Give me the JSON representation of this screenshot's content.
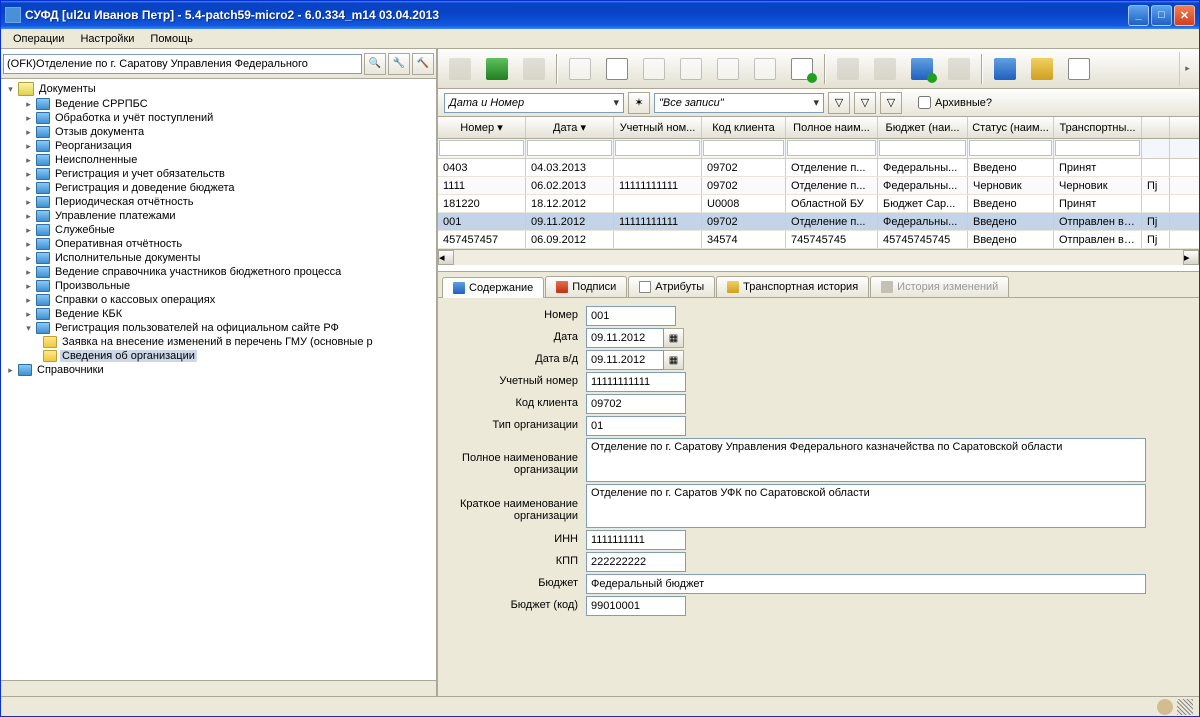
{
  "title": "СУФД [ul2u Иванов Петр] - 5.4-patch59-micro2 - 6.0.334_m14 03.04.2013",
  "menu": {
    "operations": "Операции",
    "settings": "Настройки",
    "help": "Помощь"
  },
  "search": {
    "value": "(ОFК)Отделение по г. Саратову Управления Федерального"
  },
  "tree": {
    "documents": "Документы",
    "items": [
      "Ведение СРРПБС",
      "Обработка и учёт поступлений",
      "Отзыв документа",
      "Реорганизация",
      "Неисполненные",
      "Регистрация и учет обязательств",
      "Регистрация и доведение бюджета",
      "Периодическая отчётность",
      "Управление платежами",
      "Служебные",
      "Оперативная отчётность",
      "Исполнительные документы",
      "Ведение справочника участников бюджетного процесса",
      "Произвольные",
      "Справки о кассовых операциях",
      "Ведение КБК",
      "Регистрация пользователей на официальном сайте РФ"
    ],
    "sub": {
      "a": "Заявка на внесение изменений в перечень ГМУ (основные р",
      "b": "Сведения об организации"
    },
    "references": "Справочники"
  },
  "filter": {
    "view1": "Дата и Номер",
    "view2": "\"Все записи\"",
    "archive": "Архивные?"
  },
  "grid": {
    "cols": {
      "num": "Номер ▾",
      "date": "Дата ▾",
      "acct": "Учетный ном...",
      "client": "Код клиента",
      "name": "Полное наим...",
      "budget": "Бюджет (наи...",
      "status": "Статус (наим...",
      "transport": "Транспортны..."
    },
    "rows": [
      {
        "num": "0403",
        "date": "04.03.2013",
        "acct": "",
        "client": "09702",
        "name": "Отделение п...",
        "budget": "Федеральны...",
        "status": "Введено",
        "transport": "Принят",
        "last": ""
      },
      {
        "num": "1111",
        "date": "06.02.2013",
        "acct": "11111111111",
        "client": "09702",
        "name": "Отделение п...",
        "budget": "Федеральны...",
        "status": "Черновик",
        "transport": "Черновик",
        "last": "Пј"
      },
      {
        "num": "181220",
        "date": "18.12.2012",
        "acct": "",
        "client": "U0008",
        "name": "Областной БУ",
        "budget": "Бюджет Сар...",
        "status": "Введено",
        "transport": "Принят",
        "last": ""
      },
      {
        "num": "001",
        "date": "09.11.2012",
        "acct": "11111111111",
        "client": "09702",
        "name": "Отделение п...",
        "budget": "Федеральны...",
        "status": "Введено",
        "transport": "Отправлен в ...",
        "last": "Пј"
      },
      {
        "num": "457457457",
        "date": "06.09.2012",
        "acct": "",
        "client": "34574",
        "name": "745745745",
        "budget": "45745745745",
        "status": "Введено",
        "transport": "Отправлен в ...",
        "last": "Пј"
      }
    ]
  },
  "tabs": {
    "content": "Содержание",
    "signatures": "Подписи",
    "attributes": "Атрибуты",
    "transport": "Транспортная история",
    "changes": "История изменений"
  },
  "form": {
    "labels": {
      "num": "Номер",
      "date": "Дата",
      "date_vd": "Дата в/д",
      "acct": "Учетный номер",
      "client": "Код клиента",
      "org_type": "Тип организации",
      "full_name": "Полное наименование организации",
      "short_name": "Краткое наименование организации",
      "inn": "ИНН",
      "kpp": "КПП",
      "budget": "Бюджет",
      "budget_code": "Бюджет (код)"
    },
    "values": {
      "num": "001",
      "date": "09.11.2012",
      "date_vd": "09.11.2012",
      "acct": "11111111111",
      "client": "09702",
      "org_type": "01",
      "full_name": "Отделение по г. Саратову Управления Федерального казначейства по Саратовской области",
      "short_name": "Отделение по г. Саратов УФК по Саратовской области",
      "inn": "1111111111",
      "kpp": "222222222",
      "budget": "Федеральный бюджет",
      "budget_code": "99010001"
    }
  }
}
